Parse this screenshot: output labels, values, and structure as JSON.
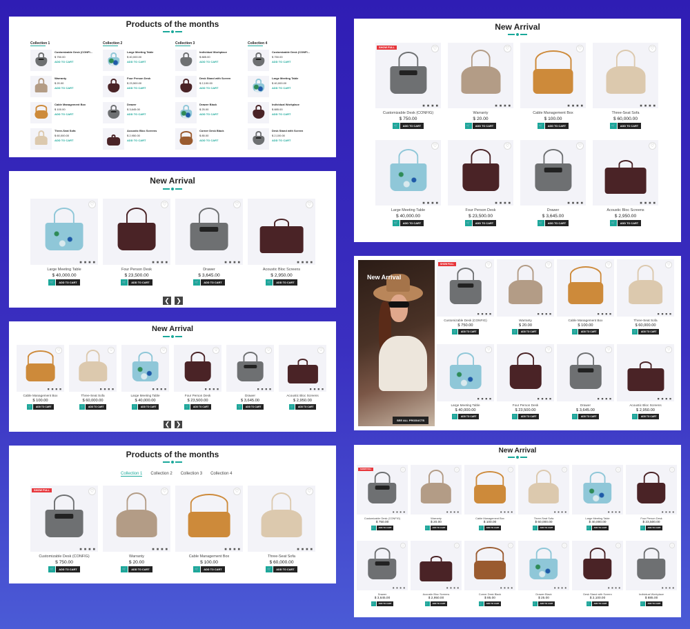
{
  "products": {
    "p1": {
      "name": "Customizable Desk (CONFIG)",
      "price": "$ 750.00"
    },
    "p2": {
      "name": "Warranty",
      "price": "$ 20.00"
    },
    "p3": {
      "name": "Cable Management Box",
      "price": "$ 100.00"
    },
    "p4": {
      "name": "Three-Seat Sofa",
      "price": "$ 60,000.00"
    },
    "p5": {
      "name": "Large Meeting Table",
      "price": "$ 40,000.00"
    },
    "p6": {
      "name": "Four Person Desk",
      "price": "$ 23,500.00"
    },
    "p7": {
      "name": "Drawer",
      "price": "$ 3,645.00"
    },
    "p8": {
      "name": "Acoustic Bloc Screens",
      "price": "$ 2,950.00"
    },
    "p9": {
      "name": "Individual Workplace",
      "price": "$ 885.00"
    },
    "p10": {
      "name": "Desk Stand with Screen",
      "price": "$ 2,100.00"
    },
    "p11": {
      "name": "Drawer Black",
      "price": "$ 25.00"
    },
    "p12": {
      "name": "Corner Desk Black",
      "price": "$ 85.00"
    },
    "p13": {
      "name": "Individual Workplace",
      "price": "$ 885.00"
    },
    "p14": {
      "name": "Large Meeting Table",
      "price": "$ 40,000.00"
    },
    "p15": {
      "name": "Desk Stand with Screen",
      "price": "$ 2,100.00"
    },
    "p16": {
      "name": "Customizable Desk (CONFIG)",
      "price": "$ 750.00"
    }
  },
  "labels": {
    "add_to_cart": "ADD TO CART",
    "add_to_cart_list": "ADD TO CART",
    "products_of_the_months": "Products of the months",
    "new_arrival": "New Arrival",
    "see_all_products": "SEE ALL PRODUCTS",
    "sale_badge": "SHOW FULL",
    "heart_icon": "♡",
    "cart_icon": "🛒",
    "dots": "■ ■ ■ ■",
    "prev": "❮",
    "next": "❯"
  },
  "collections": [
    "Collection 1",
    "Collection 2",
    "Collection 3",
    "Collection 4"
  ],
  "collection_lists": [
    [
      {
        "name": "Customizable Desk (CONFI...",
        "price": "$ 750.00"
      },
      {
        "name": "Warranty",
        "price": "$ 20.00"
      },
      {
        "name": "Cable Management Box",
        "price": "$ 100.00"
      },
      {
        "name": "Three-Seat Sofa",
        "price": "$ 60,000.00"
      }
    ],
    [
      {
        "name": "Large Meeting Table",
        "price": "$ 40,000.00"
      },
      {
        "name": "Four Person Desk",
        "price": "$ 23,500.00"
      },
      {
        "name": "Drawer",
        "price": "$ 3,645.00"
      },
      {
        "name": "Acoustic Bloc Screens",
        "price": "$ 2,950.00"
      }
    ],
    [
      {
        "name": "Individual Workplace",
        "price": "$ 885.00"
      },
      {
        "name": "Desk Stand with Screen",
        "price": "$ 2,100.00"
      },
      {
        "name": "Drawer Black",
        "price": "$ 25.00"
      },
      {
        "name": "Corner Desk Black",
        "price": "$ 85.00"
      }
    ],
    [
      {
        "name": "Customizable Desk (CONFI...",
        "price": "$ 750.00"
      },
      {
        "name": "Large Meeting Table",
        "price": "$ 40,000.00"
      },
      {
        "name": "Individual Workplace",
        "price": "$ 885.00"
      },
      {
        "name": "Desk Stand with Screen",
        "price": "$ 2,100.00"
      }
    ]
  ],
  "colors": {
    "accent": "#1aa89a",
    "dark": "#222222",
    "sale": "#e7363b",
    "bag_gray": "#6e7072",
    "bag_taupe": "#b39c86",
    "bag_tan": "#cd8a3a",
    "bag_cream": "#dcc9ae",
    "bag_floral": "#8fc7d8",
    "bag_maroon": "#4a2326",
    "bag_brown": "#9a5b2f"
  }
}
